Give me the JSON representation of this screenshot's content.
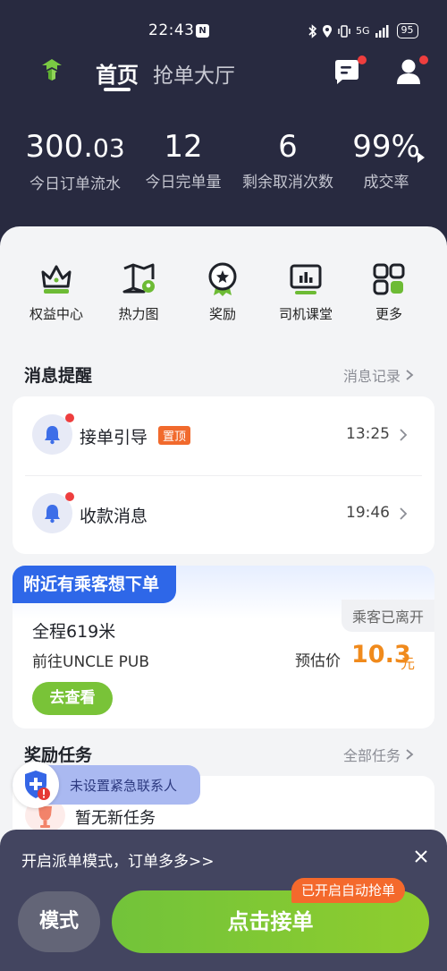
{
  "status_bar": {
    "time": "22:43",
    "network": "5G",
    "battery": "95"
  },
  "header": {
    "tab_home": "首页",
    "tab_hall": "抢单大厅"
  },
  "stats": [
    {
      "value_main": "300.",
      "value_decimal": "03",
      "label": "今日订单流水"
    },
    {
      "value_main": "12",
      "value_decimal": "",
      "label": "今日完单量"
    },
    {
      "value_main": "6",
      "value_decimal": "",
      "label": "剩余取消次数"
    },
    {
      "value_main": "99%",
      "value_decimal": "",
      "label": "成交率"
    }
  ],
  "quick_menu": [
    {
      "label": "权益中心",
      "icon": "crown-icon"
    },
    {
      "label": "热力图",
      "icon": "heatmap-icon"
    },
    {
      "label": "奖励",
      "icon": "award-icon"
    },
    {
      "label": "司机课堂",
      "icon": "classroom-icon"
    },
    {
      "label": "更多",
      "icon": "more-icon"
    }
  ],
  "messages": {
    "title": "消息提醒",
    "link": "消息记录",
    "items": [
      {
        "title": "接单引导",
        "tag": "置顶",
        "time": "13:25"
      },
      {
        "title": "收款消息",
        "tag": "",
        "time": "19:46"
      }
    ]
  },
  "nearby_order": {
    "banner": "附近有乘客想下单",
    "status": "乘客已离开",
    "distance": "全程619米",
    "destination": "前往UNCLE PUB",
    "price_label": "预估价",
    "price": "10.3",
    "price_unit": "元",
    "view_button": "去查看"
  },
  "tasks": {
    "title": "奖励任务",
    "link": "全部任务",
    "empty": "暂无新任务"
  },
  "emergency": {
    "text": "未设置紧急联系人"
  },
  "bottom_bar": {
    "promo": "开启派单模式，订单多多>>",
    "mode_button": "模式",
    "grab_button": "点击接单",
    "auto_badge": "已开启自动抢单"
  },
  "colors": {
    "header_bg": "#282a40",
    "accent_green": "#79c338",
    "price_orange": "#f08a1c",
    "banner_blue": "#2e67e8",
    "badge_orange": "#f4692c"
  }
}
